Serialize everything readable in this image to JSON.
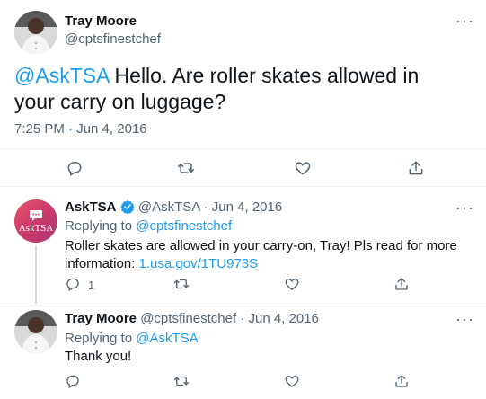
{
  "main_tweet": {
    "author_name": "Tray Moore",
    "author_handle": "@cptsfinestchef",
    "mention": "@AskTSA",
    "text": " Hello. Are roller skates allowed in your carry on luggage?",
    "timestamp": "7:25 PM · Jun 4, 2016",
    "more_label": "···"
  },
  "reply_1": {
    "author_name": "AskTSA",
    "author_handle": "@AskTSA",
    "date": "· Jun 4, 2016",
    "avatar_text": "AskTSA",
    "replying_prefix": "Replying to ",
    "replying_to": "@cptsfinestchef",
    "text": "Roller skates are allowed in your carry-on, Tray! Pls read for more information: ",
    "link": "1.usa.gov/1TU973S",
    "reply_count": "1",
    "more_label": "···"
  },
  "reply_2": {
    "author_name": "Tray Moore",
    "author_handle": "@cptsfinestchef",
    "date": "· Jun 4, 2016",
    "replying_prefix": "Replying to ",
    "replying_to": "@AskTSA",
    "text": "Thank you!",
    "more_label": "···"
  },
  "colors": {
    "link": "#1d9bf0",
    "muted": "#536471",
    "text": "#0f1419",
    "divider": "#eff3f4",
    "tsa_brand": "#d6456b"
  },
  "icons": [
    "reply-icon",
    "retweet-icon",
    "like-icon",
    "share-icon",
    "verified-badge-icon",
    "more-icon"
  ]
}
